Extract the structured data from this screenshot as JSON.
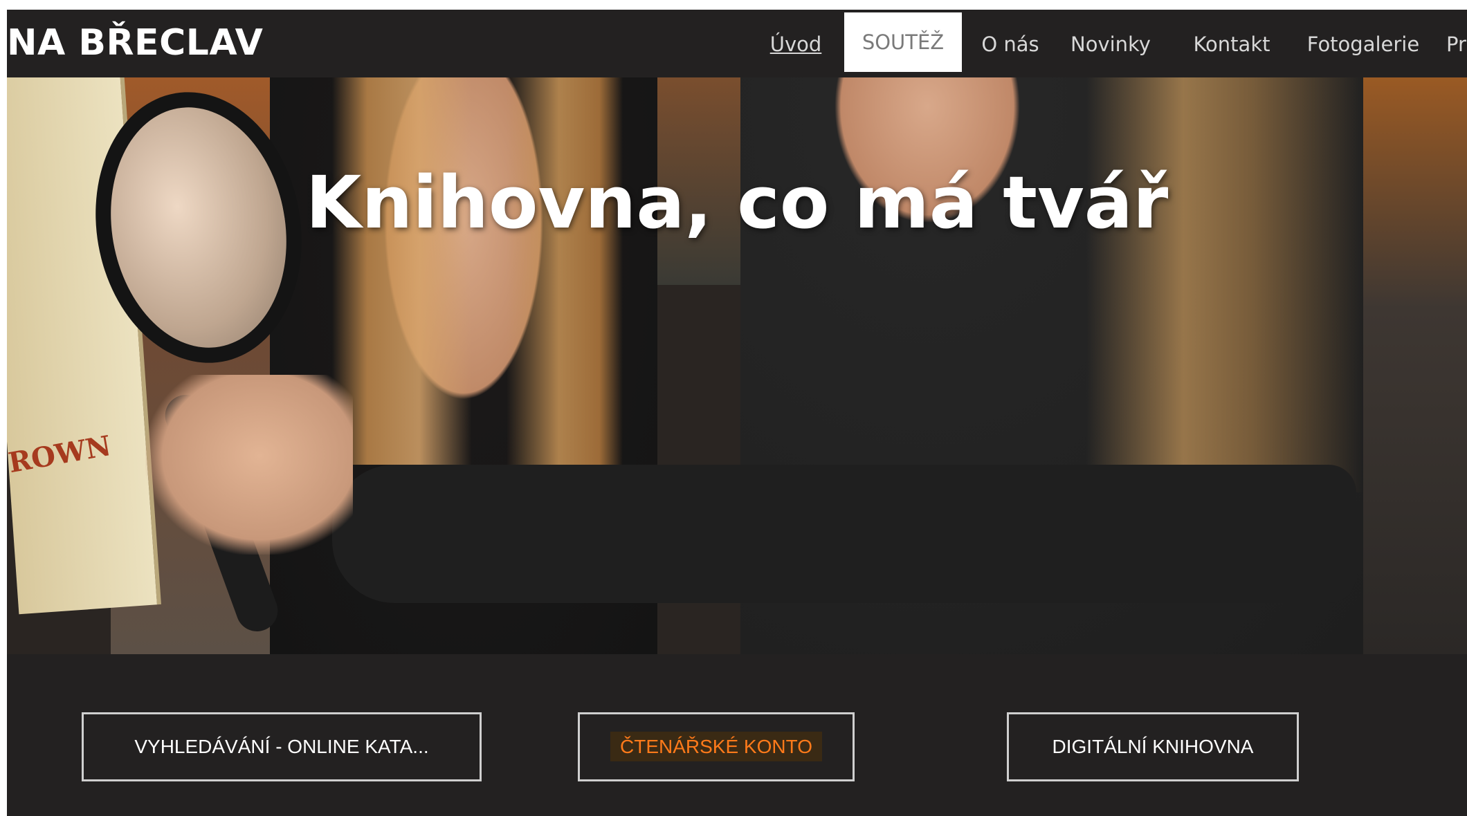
{
  "header": {
    "site_title": "NA BŘECLAV",
    "nav": [
      {
        "label": "Úvod"
      },
      {
        "label": "SOUTĚŽ"
      },
      {
        "label": "O nás"
      },
      {
        "label": "Novinky"
      },
      {
        "label": "Kontakt"
      },
      {
        "label": "Fotogalerie"
      },
      {
        "label": "Pr"
      }
    ]
  },
  "hero": {
    "title": "Knihovna, co má tvář",
    "book_text": "ROWN"
  },
  "buttons": [
    {
      "label": "VYHLEDÁVÁNÍ - ONLINE KATA..."
    },
    {
      "label": "ČTENÁŘSKÉ KONTO"
    },
    {
      "label": "DIGITÁLNÍ KNIHOVNA"
    }
  ],
  "colors": {
    "background": "#232121",
    "accent": "#ff7a1a",
    "active_tab_bg": "#ffffff"
  }
}
